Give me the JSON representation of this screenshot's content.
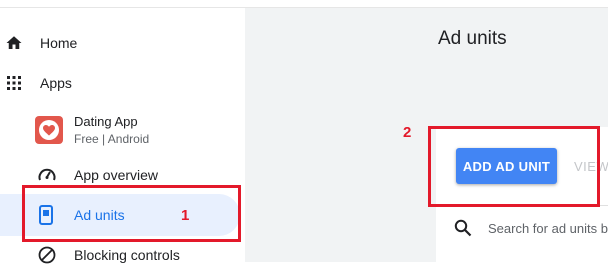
{
  "nav": {
    "home": "Home",
    "apps": "Apps",
    "app_name": "Dating App",
    "app_meta": "Free | Android",
    "app_overview": "App overview",
    "ad_units": "Ad units",
    "blocking_controls": "Blocking controls"
  },
  "main": {
    "title": "Ad units",
    "add_button": "ADD AD UNIT",
    "view_link": "VIEW",
    "search_placeholder": "Search for ad units by name"
  },
  "annotations": {
    "marker_1": "1",
    "marker_2": "2"
  },
  "colors": {
    "accent": "#1a73e8",
    "button": "#4285f4",
    "annotation": "#e3192a",
    "active_bg": "#e8f0fe",
    "app_icon": "#e2574c"
  },
  "icons": {
    "home": "home-icon",
    "apps": "apps-grid-icon",
    "app": "heart-app-icon",
    "overview": "speedometer-icon",
    "ad_units": "phone-ad-icon",
    "blocking": "block-icon",
    "search": "search-icon"
  }
}
